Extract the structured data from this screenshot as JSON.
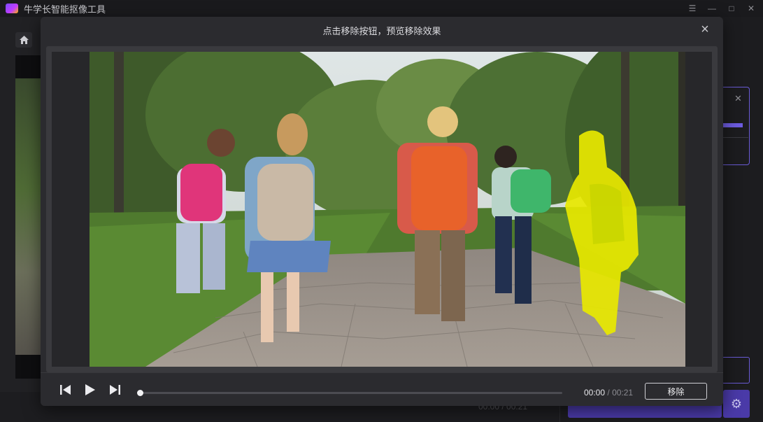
{
  "app": {
    "title": "牛学长智能抠像工具",
    "colors": {
      "accent": "#6a5bd6",
      "primary_button": "#4a3aa8",
      "mask": "#e8e800"
    }
  },
  "modal": {
    "title": "点击移除按钮，预览移除效果",
    "close_icon": "close-icon"
  },
  "player": {
    "current_time": "00:00",
    "separator": "/",
    "duration": "00:21",
    "progress_fraction": 0.0,
    "remove_label": "移除",
    "icons": [
      "prev-frame-icon",
      "play-icon",
      "next-frame-icon"
    ]
  },
  "background": {
    "time_readout": "00:00 / 00:21",
    "icons": [
      "home-icon",
      "gear-icon",
      "minimize-icon",
      "maximize-icon",
      "close-icon",
      "menu-icon"
    ]
  }
}
